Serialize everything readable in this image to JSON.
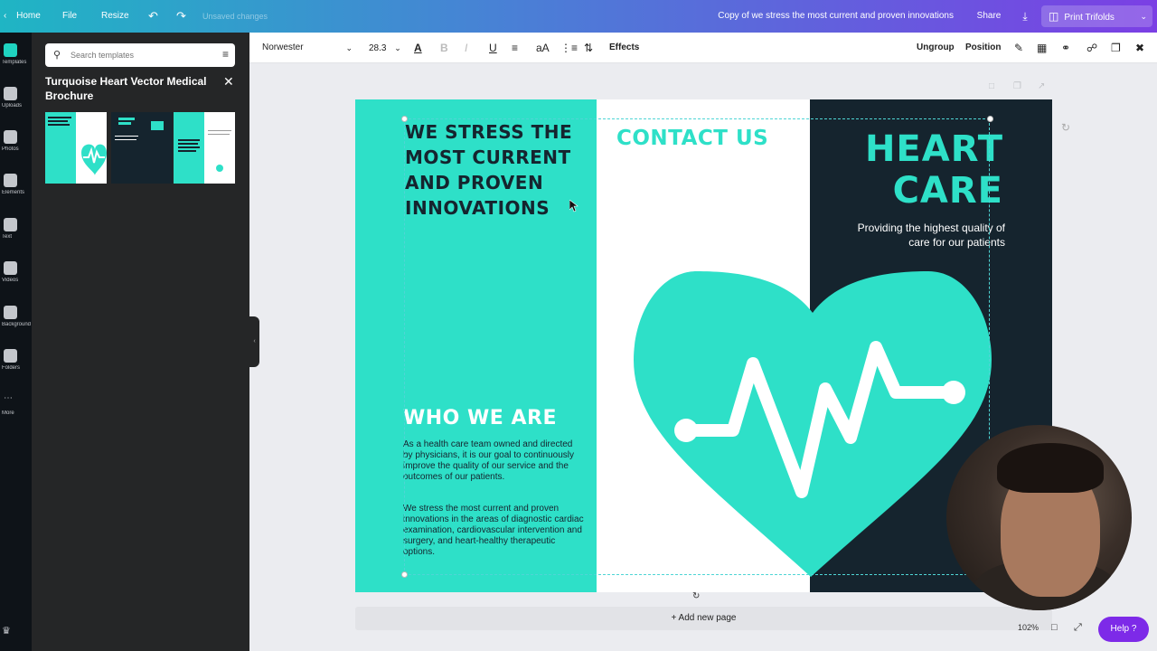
{
  "topbar": {
    "home": "Home",
    "file": "File",
    "resize": "Resize",
    "status": "Unsaved changes",
    "doc_title": "Copy of we stress the most current and proven innovations",
    "share": "Share",
    "print": "Print Trifolds"
  },
  "rail": {
    "items": [
      "Templates",
      "Uploads",
      "Photos",
      "Elements",
      "Text",
      "Videos",
      "Background",
      "Folders",
      "More"
    ]
  },
  "panel": {
    "search_placeholder": "Search templates",
    "title": "Turquoise Heart Vector Medical Brochure"
  },
  "toolbar": {
    "font": "Norwester",
    "size": "28.3",
    "effects": "Effects",
    "ungroup": "Ungroup",
    "position": "Position"
  },
  "brochure": {
    "headline": [
      "WE STRESS THE",
      "MOST CURRENT",
      "AND PROVEN",
      "INNOVATIONS"
    ],
    "who_title": "WHO WE ARE",
    "who_p1": "As a health care team owned and directed by physicians, it is our goal to continuously improve the quality of our service and the outcomes of our patients.",
    "who_p2": "We stress the most current and proven innovations in the areas of diagnostic cardiac examination, cardiovascular intervention and surgery, and heart-healthy therapeutic options.",
    "contact": "CONTACT US",
    "heart_title": [
      "HEART",
      "CARE"
    ],
    "tagline": [
      "Providing the highest quality of",
      "care for our patients"
    ]
  },
  "footer": {
    "add_page": "+ Add new page",
    "zoom": "102%",
    "help": "Help ?"
  },
  "colors": {
    "turquoise": "#2ee0c8",
    "navy": "#15242e"
  }
}
